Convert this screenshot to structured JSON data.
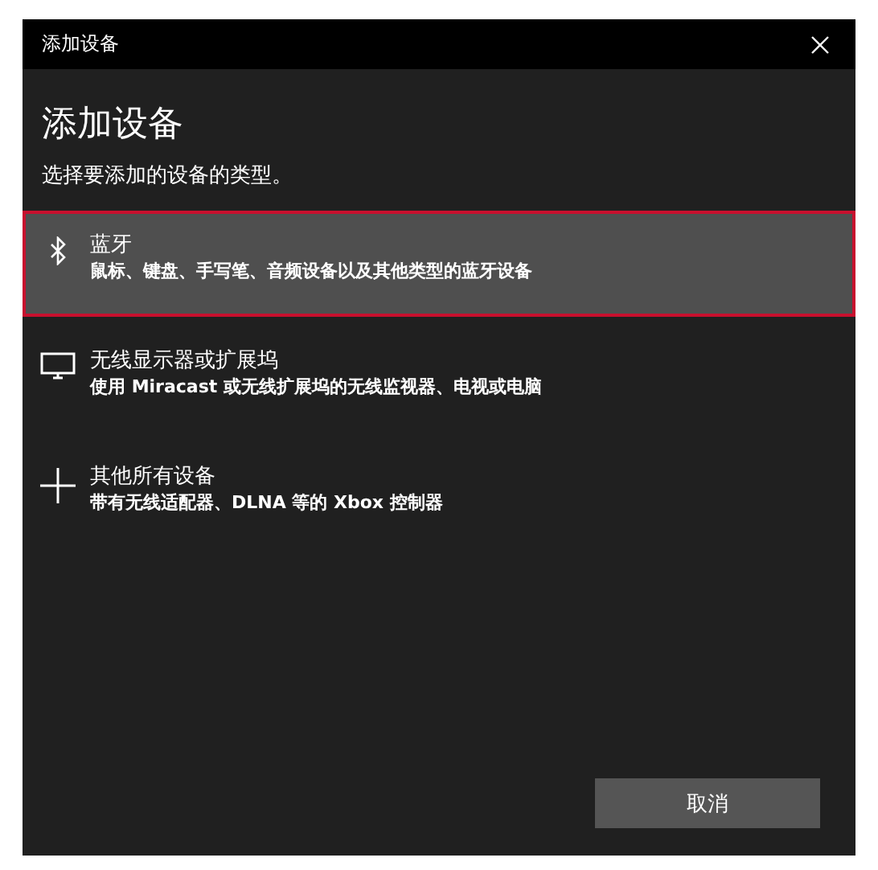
{
  "window": {
    "title": "添加设备"
  },
  "heading": "添加设备",
  "subtitle": "选择要添加的设备的类型。",
  "devices": [
    {
      "kind": "bluetooth",
      "title": "蓝牙",
      "description": "鼠标、键盘、手写笔、音频设备以及其他类型的蓝牙设备",
      "selected": true
    },
    {
      "kind": "display",
      "title": "无线显示器或扩展坞",
      "description": "使用 Miracast 或无线扩展坞的无线监视器、电视或电脑",
      "selected": false
    },
    {
      "kind": "other",
      "title": "其他所有设备",
      "description": "带有无线适配器、DLNA 等的 Xbox 控制器",
      "selected": false
    }
  ],
  "buttons": [
    "取消"
  ]
}
